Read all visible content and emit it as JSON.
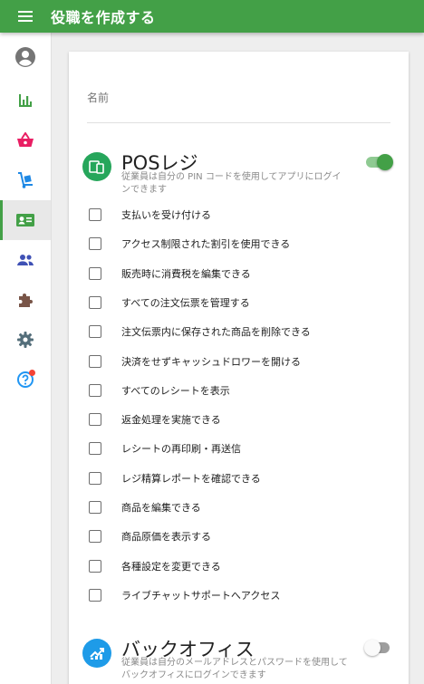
{
  "header": {
    "title": "役職を作成する",
    "menu_icon": "hamburger-menu-icon"
  },
  "sidebar": {
    "items": [
      {
        "name": "account",
        "icon": "account-circle-icon",
        "color": "#757575"
      },
      {
        "name": "reports",
        "icon": "bar-chart-icon",
        "color": "#43a047"
      },
      {
        "name": "sales",
        "icon": "shopping-basket-icon",
        "color": "#e91e63"
      },
      {
        "name": "items",
        "icon": "hand-truck-icon",
        "color": "#1e88e5"
      },
      {
        "name": "employees",
        "icon": "badge-card-icon",
        "color": "#43a047",
        "active": true
      },
      {
        "name": "customers",
        "icon": "people-icon",
        "color": "#3f51b5"
      },
      {
        "name": "integrations",
        "icon": "puzzle-piece-icon",
        "color": "#795548"
      },
      {
        "name": "settings",
        "icon": "gear-icon",
        "color": "#546e7a"
      },
      {
        "name": "help",
        "icon": "help-icon",
        "color": "#2196f3"
      }
    ]
  },
  "form": {
    "name_label": "名前"
  },
  "pos": {
    "title": "POSレジ",
    "description": "従業員は自分の PIN コードを使用してアプリにログインできます",
    "enabled": true,
    "permissions": [
      "支払いを受け付ける",
      "アクセス制限された割引を使用できる",
      "販売時に消費税を編集できる",
      "すべての注文伝票を管理する",
      "注文伝票内に保存された商品を削除できる",
      "決済をせずキャッシュドロワーを開ける",
      "すべてのレシートを表示",
      "返金処理を実施できる",
      "レシートの再印刷・再送信",
      "レジ精算レポートを確認できる",
      "商品を編集できる",
      "商品原価を表示する",
      "各種設定を変更できる",
      "ライブチャットサポートへアクセス"
    ]
  },
  "backoffice": {
    "title": "バックオフィス",
    "description": "従業員は自分のメールアドレスとパスワードを使用してバックオフィスにログインできます",
    "enabled": false
  },
  "colors": {
    "accent": "#43a047",
    "pos_icon_bg": "#26a65b",
    "backoffice_icon_bg": "#1e9be8"
  }
}
